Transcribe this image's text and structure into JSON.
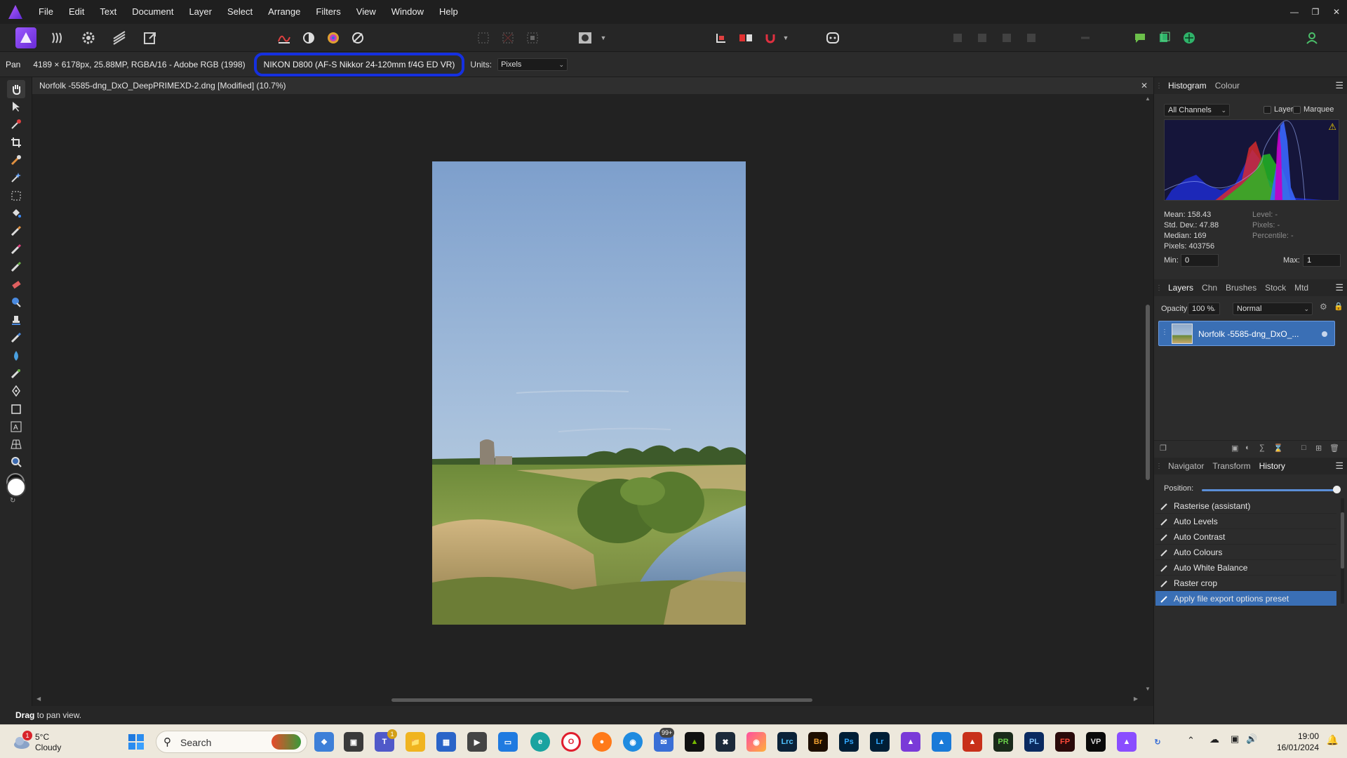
{
  "menu": [
    "File",
    "Edit",
    "Text",
    "Document",
    "Layer",
    "Select",
    "Arrange",
    "Filters",
    "View",
    "Window",
    "Help"
  ],
  "context": {
    "tool": "Pan",
    "doc_info": "4189 × 6178px, 25.88MP, RGBA/16 - Adobe RGB (1998)",
    "camera": "NIKON D800 (AF-S Nikkor 24-120mm f/4G ED VR)",
    "units_label": "Units:",
    "units_value": "Pixels"
  },
  "document": {
    "tab_title": "Norfolk -5585-dng_DxO_DeepPRIMEXD-2.dng [Modified] (10.7%)"
  },
  "status": {
    "bold": "Drag",
    "rest": " to pan view."
  },
  "histogram_panel": {
    "tabs": [
      "Histogram",
      "Colour"
    ],
    "active_tab": "Histogram",
    "channel": "All Channels",
    "layer_label": "Layer",
    "marquee_label": "Marquee",
    "warning_icon": "warning-icon",
    "stats_left": [
      "Mean: 158.43",
      "Std. Dev.: 47.88",
      "Median: 169",
      "Pixels: 403756"
    ],
    "stats_right": [
      "Level: -",
      "Pixels: -",
      "Percentile: -"
    ],
    "min_label": "Min:",
    "min_value": "0",
    "max_label": "Max:",
    "max_value": "1"
  },
  "layers_panel": {
    "tabs": [
      "Layers",
      "Chn",
      "Brushes",
      "Stock",
      "Mtd"
    ],
    "active_tab": "Layers",
    "opacity_label": "Opacity:",
    "opacity_value": "100 %",
    "blend_mode": "Normal",
    "layer_name": "Norfolk -5585-dng_DxO_..."
  },
  "history_panel": {
    "tabs": [
      "Navigator",
      "Transform",
      "History"
    ],
    "active_tab": "History",
    "position_label": "Position:",
    "items": [
      "Rasterise (assistant)",
      "Auto Levels",
      "Auto Contrast",
      "Auto Colours",
      "Auto White Balance",
      "Raster crop",
      "Apply file export options preset"
    ],
    "selected_index": 6
  },
  "taskbar": {
    "weather_temp": "5°C",
    "weather_desc": "Cloudy",
    "weather_badge": "1",
    "search_label": "Search",
    "teams_badge": "1",
    "mail_badge": "99+",
    "apps": [
      "Lrc",
      "Br",
      "Ps",
      "Lr",
      "PR",
      "PL",
      "FP",
      "VP"
    ],
    "time": "19:00",
    "date": "16/01/2024"
  },
  "colors": {
    "accent": "#3a6fb5",
    "highlight_ring": "#1530e0",
    "affinity_purple": "#8a4dff"
  }
}
